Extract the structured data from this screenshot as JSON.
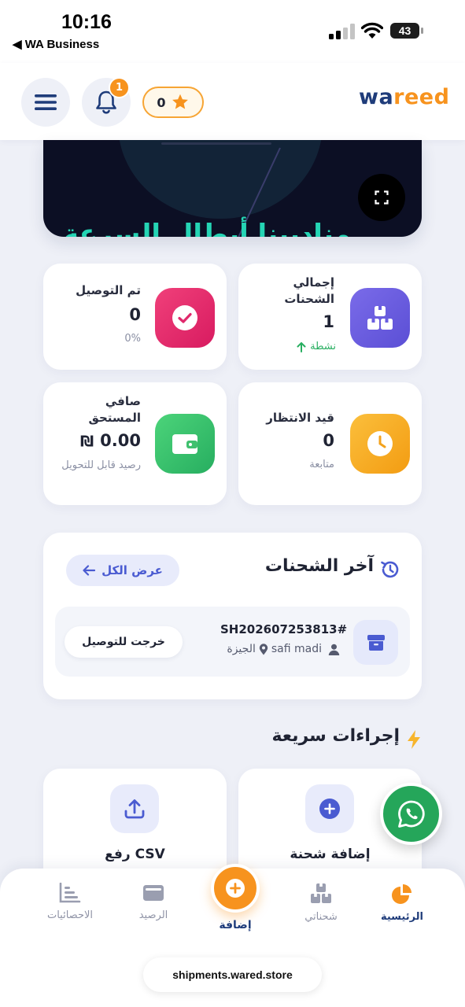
{
  "status_bar": {
    "time": "10:16",
    "back_label": "◀ WA Business",
    "battery": "43"
  },
  "header": {
    "notification_count": "1",
    "points": "0",
    "logo_part1": "wa",
    "logo_part2": "reed"
  },
  "banner": {
    "text": "مناديبنا أبطال السرعة"
  },
  "stats": {
    "total_shipments": {
      "label": "إجمالي الشحنات",
      "value": "1",
      "sub": "نشطة"
    },
    "delivered": {
      "label": "تم التوصيل",
      "value": "0",
      "sub": "0%"
    },
    "pending": {
      "label": "قيد الانتظار",
      "value": "0",
      "sub": "متابعة"
    },
    "net_due": {
      "label": "صافي المستحق",
      "value": "0.00",
      "currency": "₪",
      "sub": "رصيد قابل للتحويل"
    }
  },
  "last_shipments": {
    "title": "آخر الشحنات",
    "view_all": "عرض الكل",
    "items": [
      {
        "id": "SH202607253813#",
        "customer": "safi madi",
        "city": "الجيزة",
        "status": "خرجت للتوصيل"
      }
    ]
  },
  "quick_actions": {
    "title": "إجراءات سريعة",
    "add_shipment": "إضافة شحنة",
    "upload_csv": "رفع CSV"
  },
  "bottom_nav": {
    "home": "الرئيسية",
    "my_shipments": "شحناتي",
    "add": "إضافة",
    "balance": "الرصيد",
    "statistics": "الاحصائيات"
  },
  "browser": {
    "url": "shipments.wared.store"
  },
  "colors": {
    "brand_navy": "#1f3c7a",
    "brand_orange": "#f7931e",
    "whatsapp": "#25a65a"
  }
}
